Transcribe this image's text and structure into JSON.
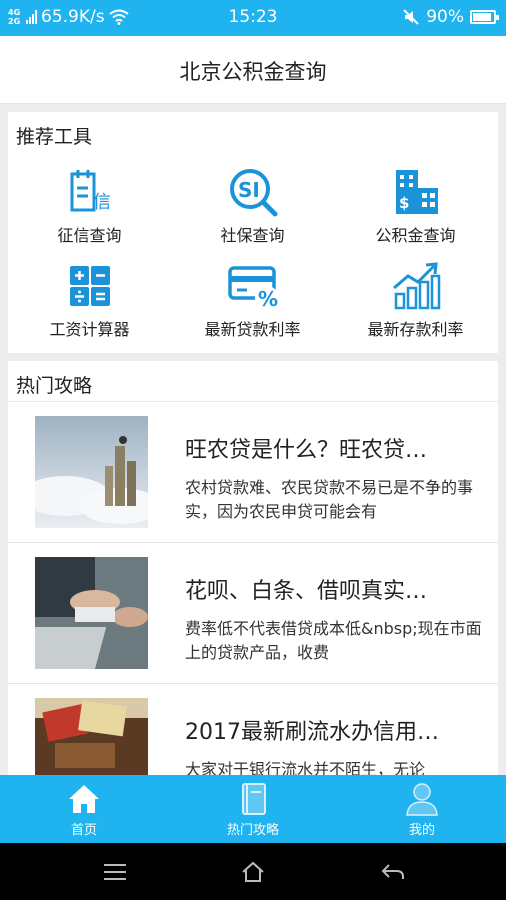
{
  "status_bar": {
    "network_type": "4G",
    "network_type2": "2G",
    "speed": "65.9K/s",
    "time": "15:23",
    "battery": "90%",
    "battery_level": 0.9,
    "icons": [
      "signal-icon",
      "wifi-icon",
      "mute-icon",
      "battery-icon"
    ]
  },
  "header": {
    "title": "北京公积金查询"
  },
  "tools": {
    "section_title": "推荐工具",
    "items": [
      {
        "label": "征信查询",
        "icon": "credit-report-icon"
      },
      {
        "label": "社保查询",
        "icon": "social-security-search-icon"
      },
      {
        "label": "公积金查询",
        "icon": "housing-fund-building-icon"
      },
      {
        "label": "工资计算器",
        "icon": "calculator-icon"
      },
      {
        "label": "最新贷款利率",
        "icon": "loan-rate-card-icon"
      },
      {
        "label": "最新存款利率",
        "icon": "deposit-rate-chart-icon"
      }
    ]
  },
  "hot": {
    "section_title": "热门攻略",
    "articles": [
      {
        "title": "旺农贷是什么？旺农贷…",
        "desc": "农村贷款难、农民贷款不易已是不争的事实，因为农民申贷可能会有"
      },
      {
        "title": "花呗、白条、借呗真实…",
        "desc": "费率低不代表借贷成本低&nbsp;现在市面上的贷款产品，收费"
      },
      {
        "title": "2017最新刷流水办信用…",
        "desc": "大家对于银行流水并不陌生，无论"
      }
    ]
  },
  "tabbar": {
    "tabs": [
      {
        "label": "首页",
        "icon": "home-icon"
      },
      {
        "label": "热门攻略",
        "icon": "book-icon"
      },
      {
        "label": "我的",
        "icon": "user-icon"
      }
    ]
  },
  "colors": {
    "accent": "#1fb3ef",
    "icon_blue": "#1a93d9",
    "background": "#ededf0"
  }
}
